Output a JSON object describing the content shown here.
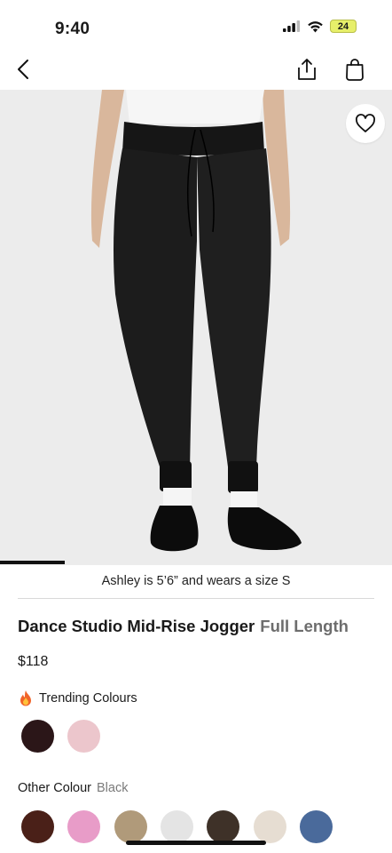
{
  "status_bar": {
    "time": "9:40",
    "battery": "24"
  },
  "nav": {
    "back_icon": "chevron-left-icon",
    "share_icon": "share-icon",
    "bag_icon": "shopping-bag-icon"
  },
  "gallery": {
    "progress_fraction": 0.165,
    "caption": "Ashley is 5’6” and wears a size S"
  },
  "product": {
    "name": "Dance Studio Mid-Rise Jogger",
    "length": "Full Length",
    "price": "$118"
  },
  "trending": {
    "label": "Trending Colours",
    "icon": "fire-emoji-icon",
    "swatches": [
      "#2b1618",
      "#ecc6cc"
    ]
  },
  "other_colour": {
    "label": "Other Colour",
    "selected": "Black",
    "swatches": [
      "#4a2018",
      "#e89cc8",
      "#b09a7a",
      "#e4e4e4",
      "#3e3128",
      "#e6ddd2",
      "#4a6a9b"
    ]
  }
}
